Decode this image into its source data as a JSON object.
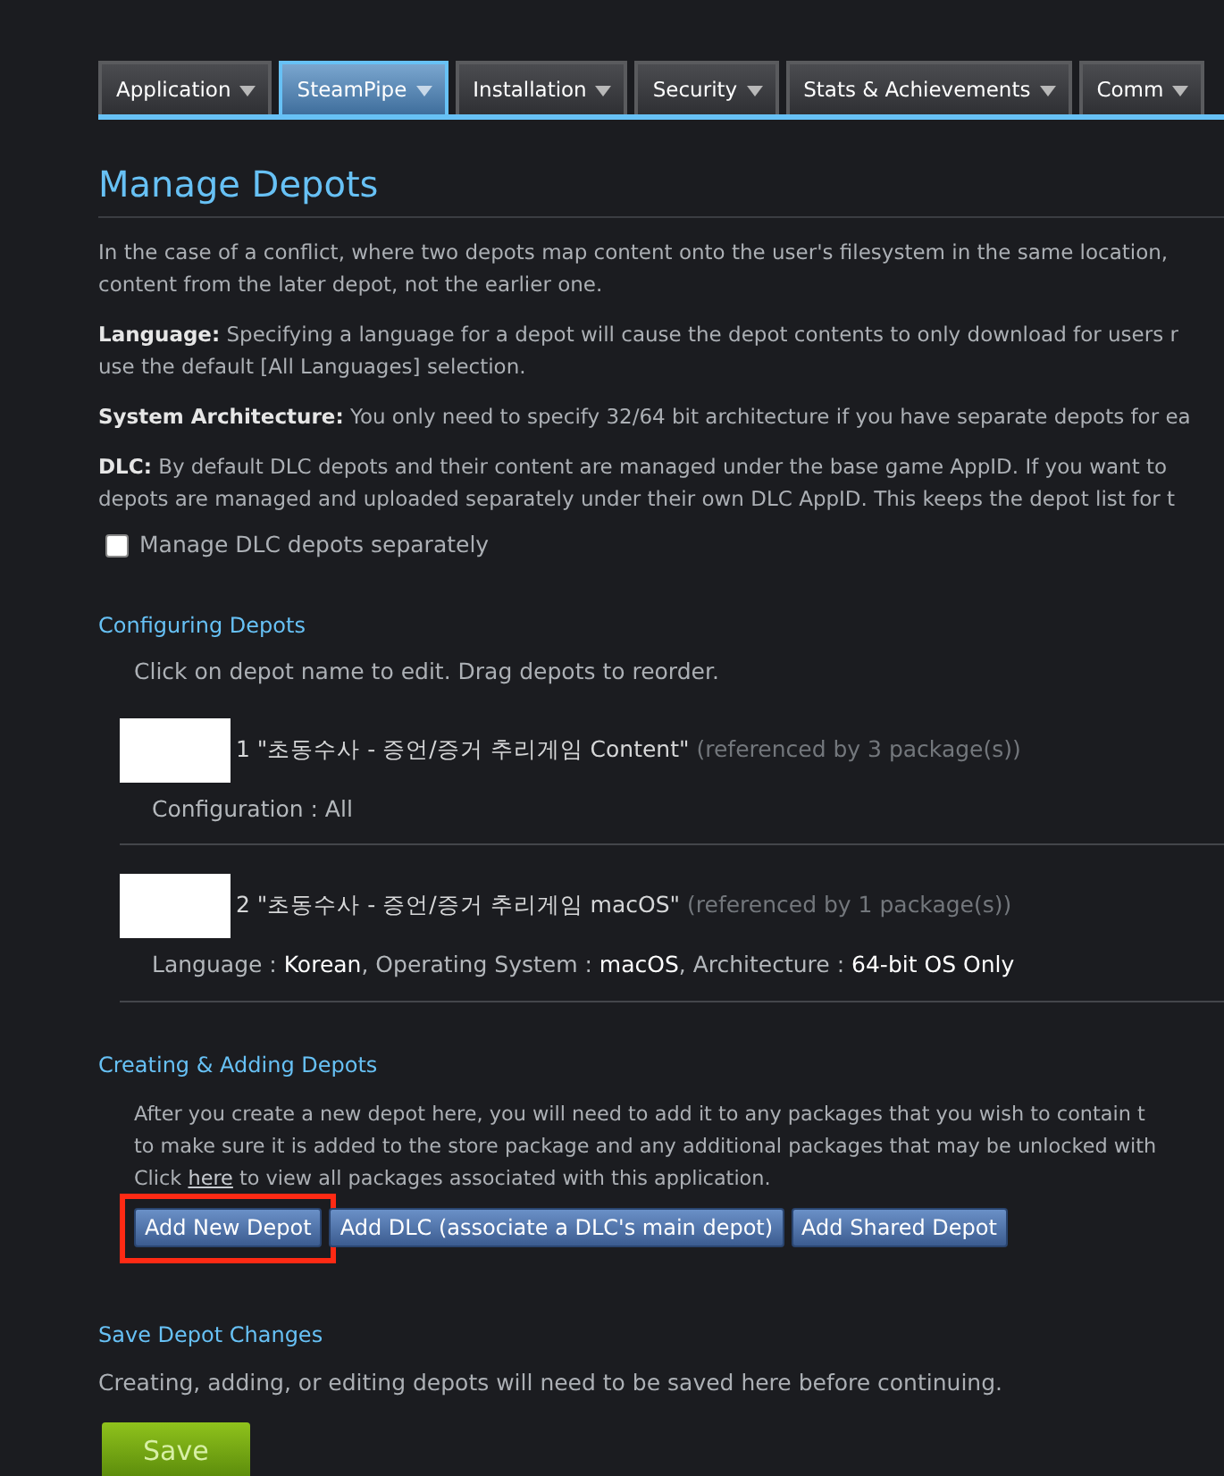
{
  "tabs": [
    {
      "label": "Application",
      "selected": false
    },
    {
      "label": "SteamPipe",
      "selected": true
    },
    {
      "label": "Installation",
      "selected": false
    },
    {
      "label": "Security",
      "selected": false
    },
    {
      "label": "Stats & Achievements",
      "selected": false
    },
    {
      "label": "Comm",
      "selected": false
    }
  ],
  "title": "Manage Depots",
  "intro": [
    {
      "lines": [
        "In the case of a conflict, where two depots map content onto the user's filesystem in the same location,",
        "content from the later depot, not the earlier one."
      ]
    },
    {
      "lines": [
        "**Language:** Specifying a language for a depot will cause the depot contents to only download for users r",
        "use the default [All Languages] selection."
      ]
    },
    {
      "lines": [
        "**System Architecture:** You only need to specify 32/64 bit architecture if you have separate depots for ea"
      ]
    },
    {
      "lines": [
        "**DLC:** By default DLC depots and their content are managed under the base game AppID. If you want to",
        "depots are managed and uploaded separately under their own DLC AppID. This keeps the depot list for t"
      ]
    }
  ],
  "dlc_checkbox": {
    "label": "Manage DLC depots separately",
    "checked": false
  },
  "configuring": {
    "heading": "Configuring Depots",
    "hint": "Click on depot name to edit. Drag depots to reorder.",
    "depots": [
      {
        "redacted": true,
        "name": "1 \"초동수사 - 증언/증거 추리게임 Content\"",
        "referenced": "(referenced by 3 package(s))",
        "details": "Configuration : All"
      },
      {
        "redacted": true,
        "name": "2 \"초동수사 - 증언/증거 추리게임 macOS\"",
        "referenced": "(referenced by 1 package(s))",
        "details": "Language : **Korean**, Operating System : **macOS**, Architecture : **64-bit OS Only**"
      }
    ]
  },
  "creating": {
    "heading": "Creating & Adding Depots",
    "lines": [
      "After you create a new depot here, you will need to add it to any packages that you wish to contain t",
      "to make sure it is added to the store package and any additional packages that may be unlocked with"
    ],
    "link_line": {
      "before": "Click",
      "link": "here",
      "after": "to view all packages associated with this application."
    },
    "buttons": [
      {
        "label": "Add New Depot",
        "highlighted": true
      },
      {
        "label": "Add DLC (associate a DLC's main depot)",
        "highlighted": false
      },
      {
        "label": "Add Shared Depot",
        "highlighted": false
      }
    ]
  },
  "save": {
    "heading": "Save Depot Changes",
    "text": "Creating, adding, or editing depots will need to be saved here before continuing.",
    "button": "Save"
  }
}
